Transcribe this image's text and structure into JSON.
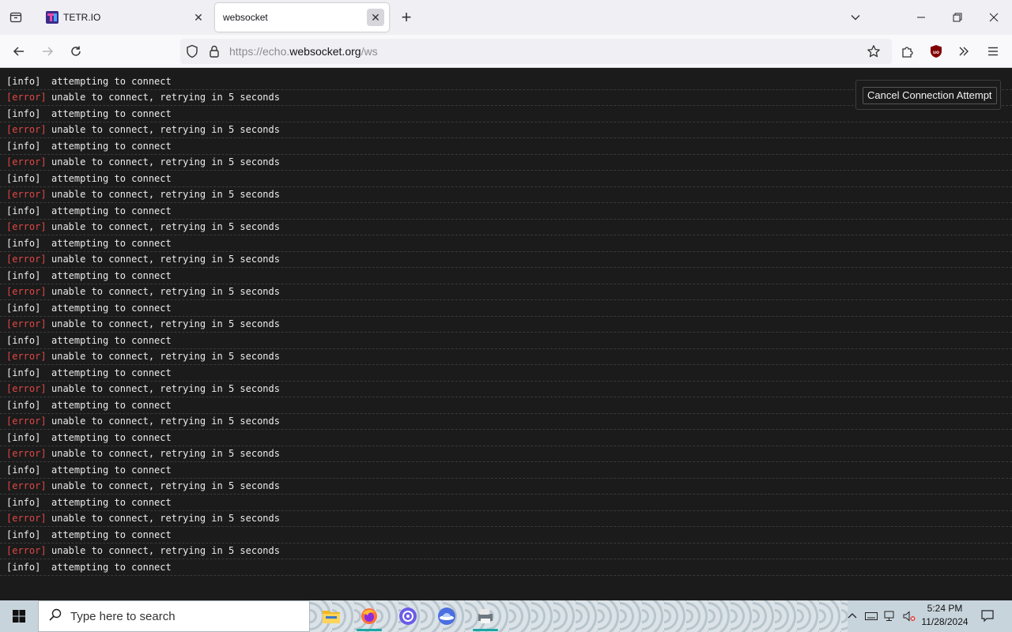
{
  "browser": {
    "tabs": [
      {
        "title": "TETR.IO",
        "active": false
      },
      {
        "title": "websocket",
        "active": true
      }
    ],
    "url": {
      "prefix": "https://echo.",
      "host": "websocket.org",
      "path": "/ws"
    }
  },
  "page": {
    "cancel_button": "Cancel Connection Attempt",
    "log": [
      {
        "level": "[info]",
        "type": "info",
        "message": "attempting to connect"
      },
      {
        "level": "[error]",
        "type": "error",
        "message": "unable to connect, retrying in 5 seconds"
      },
      {
        "level": "[info]",
        "type": "info",
        "message": "attempting to connect"
      },
      {
        "level": "[error]",
        "type": "error",
        "message": "unable to connect, retrying in 5 seconds"
      },
      {
        "level": "[info]",
        "type": "info",
        "message": "attempting to connect"
      },
      {
        "level": "[error]",
        "type": "error",
        "message": "unable to connect, retrying in 5 seconds"
      },
      {
        "level": "[info]",
        "type": "info",
        "message": "attempting to connect"
      },
      {
        "level": "[error]",
        "type": "error",
        "message": "unable to connect, retrying in 5 seconds"
      },
      {
        "level": "[info]",
        "type": "info",
        "message": "attempting to connect"
      },
      {
        "level": "[error]",
        "type": "error",
        "message": "unable to connect, retrying in 5 seconds"
      },
      {
        "level": "[info]",
        "type": "info",
        "message": "attempting to connect"
      },
      {
        "level": "[error]",
        "type": "error",
        "message": "unable to connect, retrying in 5 seconds"
      },
      {
        "level": "[info]",
        "type": "info",
        "message": "attempting to connect"
      },
      {
        "level": "[error]",
        "type": "error",
        "message": "unable to connect, retrying in 5 seconds"
      },
      {
        "level": "[info]",
        "type": "info",
        "message": "attempting to connect"
      },
      {
        "level": "[error]",
        "type": "error",
        "message": "unable to connect, retrying in 5 seconds"
      },
      {
        "level": "[info]",
        "type": "info",
        "message": "attempting to connect"
      },
      {
        "level": "[error]",
        "type": "error",
        "message": "unable to connect, retrying in 5 seconds"
      },
      {
        "level": "[info]",
        "type": "info",
        "message": "attempting to connect"
      },
      {
        "level": "[error]",
        "type": "error",
        "message": "unable to connect, retrying in 5 seconds"
      },
      {
        "level": "[info]",
        "type": "info",
        "message": "attempting to connect"
      },
      {
        "level": "[error]",
        "type": "error",
        "message": "unable to connect, retrying in 5 seconds"
      },
      {
        "level": "[info]",
        "type": "info",
        "message": "attempting to connect"
      },
      {
        "level": "[error]",
        "type": "error",
        "message": "unable to connect, retrying in 5 seconds"
      },
      {
        "level": "[info]",
        "type": "info",
        "message": "attempting to connect"
      },
      {
        "level": "[error]",
        "type": "error",
        "message": "unable to connect, retrying in 5 seconds"
      },
      {
        "level": "[info]",
        "type": "info",
        "message": "attempting to connect"
      },
      {
        "level": "[error]",
        "type": "error",
        "message": "unable to connect, retrying in 5 seconds"
      },
      {
        "level": "[info]",
        "type": "info",
        "message": "attempting to connect"
      },
      {
        "level": "[error]",
        "type": "error",
        "message": "unable to connect, retrying in 5 seconds"
      },
      {
        "level": "[info]",
        "type": "info",
        "message": "attempting to connect"
      }
    ]
  },
  "taskbar": {
    "search_placeholder": "Type here to search",
    "time": "5:24 PM",
    "date": "11/28/2024",
    "apps": [
      "file-explorer",
      "firefox",
      "app-bubble",
      "app-ufo",
      "app-printer"
    ]
  },
  "colors": {
    "page_bg": "#1b1b1b",
    "error": "#e04747",
    "info": "#ececec",
    "accent": "#1ea4a4"
  }
}
